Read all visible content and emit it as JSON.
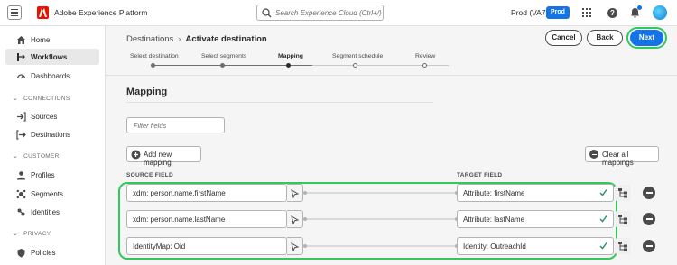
{
  "app": {
    "title": "Adobe Experience Platform"
  },
  "search": {
    "placeholder": "Search Experience Cloud (Ctrl+/)"
  },
  "org": {
    "name": "Prod (VA7)",
    "sandbox_badge": "Prod"
  },
  "sidebar": {
    "items_top": [
      {
        "label": "Home",
        "icon": "home-icon"
      },
      {
        "label": "Workflows",
        "icon": "workflows-icon",
        "active": true
      },
      {
        "label": "Dashboards",
        "icon": "dashboards-icon"
      }
    ],
    "sections": [
      {
        "title": "CONNECTIONS",
        "items": [
          {
            "label": "Sources",
            "icon": "sources-icon"
          },
          {
            "label": "Destinations",
            "icon": "destinations-icon"
          }
        ]
      },
      {
        "title": "CUSTOMER",
        "items": [
          {
            "label": "Profiles",
            "icon": "profiles-icon"
          },
          {
            "label": "Segments",
            "icon": "segments-icon"
          },
          {
            "label": "Identities",
            "icon": "identities-icon"
          }
        ]
      },
      {
        "title": "PRIVACY",
        "items": [
          {
            "label": "Policies",
            "icon": "policies-icon"
          }
        ]
      }
    ]
  },
  "breadcrumb": {
    "parent": "Destinations",
    "separator": "›",
    "current": "Activate destination"
  },
  "actions": {
    "cancel": "Cancel",
    "back": "Back",
    "next": "Next"
  },
  "steps": [
    {
      "label": "Select destination",
      "state": "done"
    },
    {
      "label": "Select segments",
      "state": "done"
    },
    {
      "label": "Mapping",
      "state": "current"
    },
    {
      "label": "Segment schedule",
      "state": "todo"
    },
    {
      "label": "Review",
      "state": "todo"
    }
  ],
  "mapping": {
    "title": "Mapping",
    "filter_placeholder": "Filter fields",
    "add_label": "Add new mapping",
    "clear_label": "Clear all mappings",
    "source_header": "SOURCE FIELD",
    "target_header": "TARGET FIELD",
    "rows": [
      {
        "source": "xdm: person.name.firstName",
        "target": "Attribute: firstName"
      },
      {
        "source": "xdm: person.name.lastName",
        "target": "Attribute: lastName"
      },
      {
        "source": "IdentityMap: Oid",
        "target": "Identity: OutreachId"
      }
    ]
  },
  "colors": {
    "accent": "#1473e6",
    "highlight": "#34c759",
    "brand": "#eb1000"
  }
}
